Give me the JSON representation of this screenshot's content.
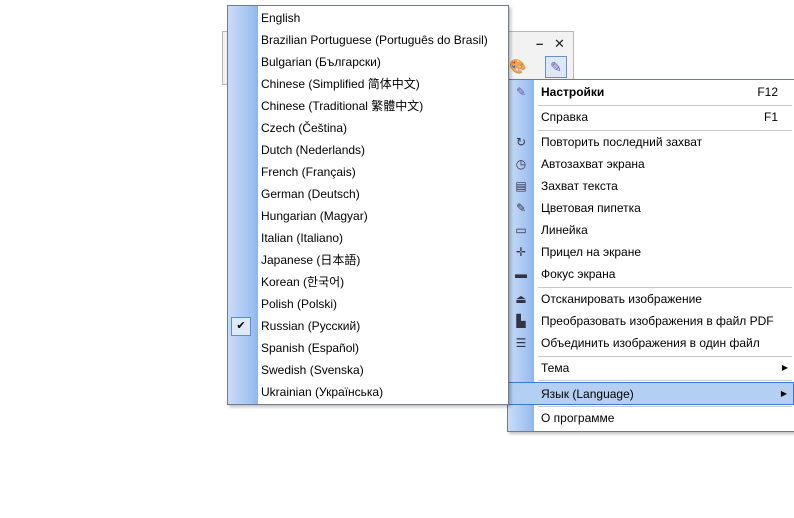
{
  "window": {
    "minimize": "–",
    "close": "✕"
  },
  "toolbar": {
    "theme_icon": "palette-icon",
    "settings_icon": "settings-icon"
  },
  "language_menu": {
    "items": [
      {
        "label": "English"
      },
      {
        "label": "Brazilian Portuguese (Português do Brasil)"
      },
      {
        "label": "Bulgarian (Български)"
      },
      {
        "label": "Chinese (Simplified 简体中文)"
      },
      {
        "label": "Chinese (Traditional 繁體中文)"
      },
      {
        "label": "Czech (Čeština)"
      },
      {
        "label": "Dutch (Nederlands)"
      },
      {
        "label": "French (Français)"
      },
      {
        "label": "German (Deutsch)"
      },
      {
        "label": "Hungarian (Magyar)"
      },
      {
        "label": "Italian (Italiano)"
      },
      {
        "label": "Japanese (日本語)"
      },
      {
        "label": "Korean (한국어)"
      },
      {
        "label": "Polish (Polski)"
      },
      {
        "label": "Russian (Русский)",
        "checked": true,
        "check": "✔"
      },
      {
        "label": "Spanish (Español)"
      },
      {
        "label": "Swedish (Svenska)"
      },
      {
        "label": "Ukrainian (Українська)"
      }
    ]
  },
  "main_menu": {
    "settings": {
      "label": "Настройки",
      "shortcut": "F12"
    },
    "help": {
      "label": "Справка",
      "shortcut": "F1"
    },
    "capture": [
      {
        "label": "Повторить последний захват",
        "icon": "↻"
      },
      {
        "label": "Автозахват экрана",
        "icon": "◷"
      },
      {
        "label": "Захват текста",
        "icon": "▤"
      },
      {
        "label": "Цветовая пипетка",
        "icon": "✎"
      },
      {
        "label": "Линейка",
        "icon": "▭"
      },
      {
        "label": "Прицел на экране",
        "icon": "✛"
      },
      {
        "label": "Фокус экрана",
        "icon": "▬"
      }
    ],
    "tools": [
      {
        "label": "Отсканировать изображение",
        "icon": "⏏"
      },
      {
        "label": "Преобразовать изображения в файл PDF",
        "icon": "▙"
      },
      {
        "label": "Объединить изображения в один файл",
        "icon": "☰"
      }
    ],
    "theme": {
      "label": "Тема",
      "arrow": "▶"
    },
    "language": {
      "label": "Язык (Language)",
      "arrow": "▶"
    },
    "about": {
      "label": "О программе"
    }
  }
}
